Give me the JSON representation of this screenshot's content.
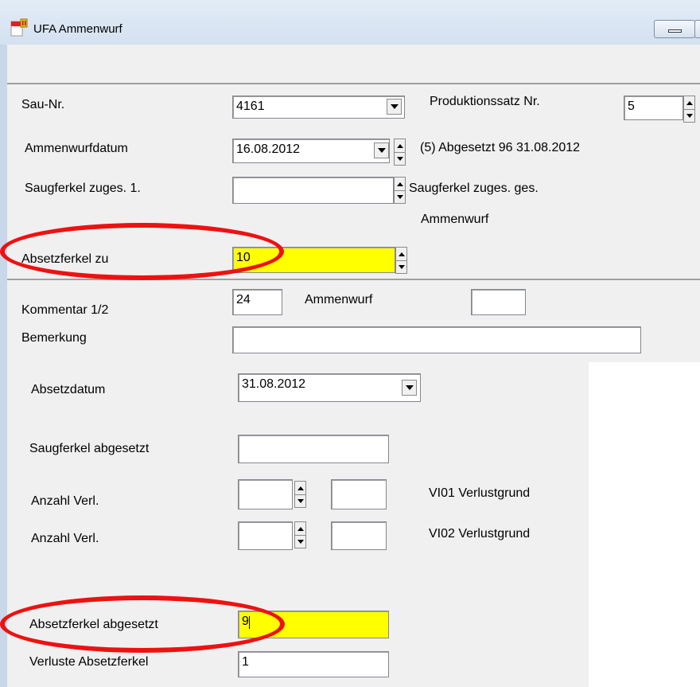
{
  "window": {
    "title": "UFA Ammenwurf"
  },
  "form": {
    "sau_nr": {
      "label": "Sau-Nr.",
      "value": "4161"
    },
    "produktionssatz": {
      "label": "Produktionssatz Nr.",
      "value": "5"
    },
    "ammenwurfdatum": {
      "label": "Ammenwurfdatum",
      "value": "16.08.2012",
      "info": "(5) Abgesetzt 96 31.08.2012"
    },
    "saugferkel_zuges_1": {
      "label": "Saugferkel zuges.  1.",
      "value": "",
      "ges_label": "Saugferkel zuges. ges.",
      "ammenwurf_label": "Ammenwurf"
    },
    "absetzferkel_zu": {
      "label": "Absetzferkel zu",
      "value": "10"
    },
    "kommentar": {
      "label": "Kommentar 1/2",
      "value": "24",
      "ammenwurf_label": "Ammenwurf",
      "value2": ""
    },
    "bemerkung": {
      "label": "Bemerkung",
      "value": ""
    },
    "absetzdatum": {
      "label": "Absetzdatum",
      "value": "31.08.2012"
    },
    "saugferkel_abgesetzt": {
      "label": "Saugferkel abgesetzt",
      "value": ""
    },
    "verlust1": {
      "label": "Anzahl Verl.",
      "value": "",
      "code": "",
      "grund_label": "VI01 Verlustgrund"
    },
    "verlust2": {
      "label": "Anzahl Verl.",
      "value": "",
      "code": "",
      "grund_label": "VI02 Verlustgrund"
    },
    "absetzferkel_abgesetzt": {
      "label": "Absetzferkel abgesetzt",
      "value": "9"
    },
    "verluste_absetzferkel": {
      "label": "Verluste Absetzferkel",
      "value": "1"
    }
  },
  "colors": {
    "highlight": "#ffff00",
    "annotation": "#ee1111",
    "panel": "#f0f0f0"
  }
}
